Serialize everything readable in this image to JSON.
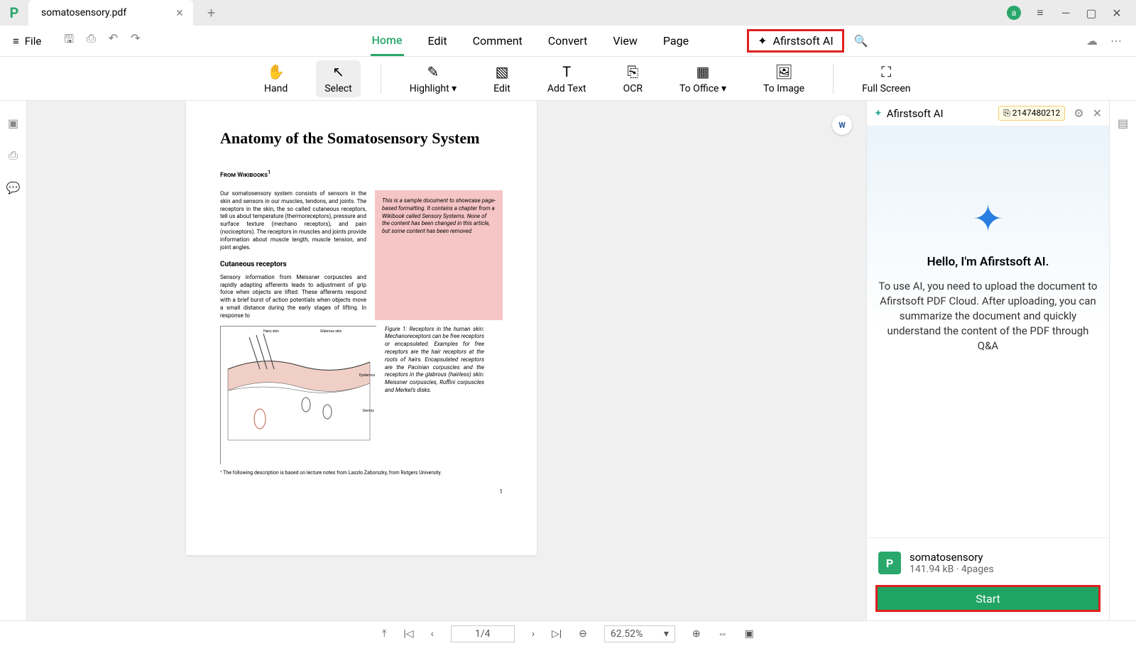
{
  "window": {
    "tab_title": "somatosensory.pdf"
  },
  "menu": {
    "file": "File"
  },
  "tabs": {
    "home": "Home",
    "edit": "Edit",
    "comment": "Comment",
    "convert": "Convert",
    "view": "View",
    "page": "Page",
    "ai": "Afirstsoft AI"
  },
  "toolbar": {
    "hand": "Hand",
    "select": "Select",
    "highlight": "Highlight",
    "edit": "Edit",
    "addtext": "Add Text",
    "ocr": "OCR",
    "tooffice": "To Office",
    "toimage": "To Image",
    "fullscreen": "Full Screen"
  },
  "doc": {
    "title": "Anatomy of the Somatosensory System",
    "source": "From Wikibooks",
    "p1": "Our somatosensory system consists of sensors in the skin and sensors in our muscles, tendons, and joints. The receptors in the skin, the so called cutaneous receptors, tell us about temperature (thermoreceptors), pressure and surface texture (mechano receptors), and pain (nociceptors). The receptors in muscles and joints provide information about muscle length, muscle tension, and joint angles.",
    "notice": "This is a sample document to showcase page-based formatting. It contains a chapter from a Wikibook called Sensory Systems. None of the content has been changed in this article, but some content has been removed.",
    "h2": "Cutaneous receptors",
    "p2": "Sensory information from Meissner corpuscles and rapidly adapting afferents leads to adjustment of grip force when objects are lifted. These afferents respond with a brief burst of action potentials when objects move a small distance during the early stages of lifting. In response to",
    "figcap": "Figure 1: Receptors in the human skin: Mechanoreceptors can be free receptors or encapsulated. Examples for free receptors are the hair receptors at the roots of hairs. Encapsulated receptors are the Pacinian corpuscles and the receptors in the glabrous (hairless) skin: Meissner corpuscles, Ruffini corpuscles and Merkel's disks.",
    "footnote": "¹ The following description is based on lecture notes from Laszlo Zaborszky, from Rutgers University.",
    "pagenum": "1",
    "hairy": "Hairy skin",
    "glabrous": "Glabrous skin",
    "epidermis": "Epidermis",
    "dermis": "Dermis"
  },
  "ai": {
    "panel_title": "Afirstsoft AI",
    "id": "2147480212",
    "greeting": "Hello, I'm Afirstsoft AI.",
    "description": "To use AI, you need to upload the document to Afirstsoft PDF Cloud. After uploading, you can summarize the document and quickly understand the content of the PDF through Q&A",
    "doc_name": "somatosensory",
    "doc_meta": "141.94 kB · 4pages",
    "start": "Start"
  },
  "status": {
    "page": "1/4",
    "zoom": "62.52%"
  }
}
